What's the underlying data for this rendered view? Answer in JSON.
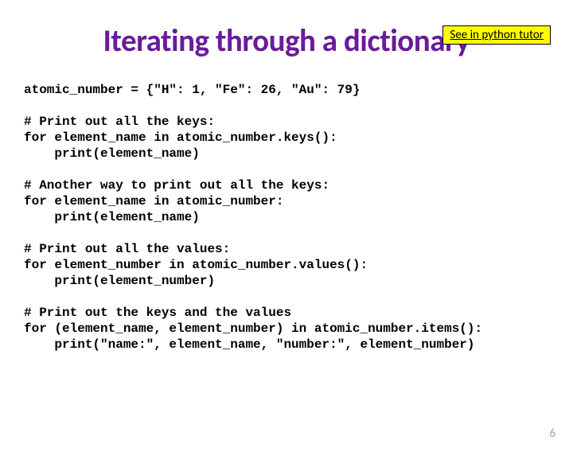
{
  "header": {
    "tutor_link": "See in python tutor"
  },
  "title": "Iterating through a dictionary",
  "code": {
    "line1": "atomic_number = {\"H\": 1, \"Fe\": 26, \"Au\": 79}",
    "block1_header": "# Print out all the keys:",
    "block1_line1": "for element_name in atomic_number.keys():",
    "block1_line2": "    print(element_name)",
    "block2_header": "# Another way to print out all the keys:",
    "block2_line1": "for element_name in atomic_number:",
    "block2_line2": "    print(element_name)",
    "block3_header": "# Print out all the values:",
    "block3_line1": "for element_number in atomic_number.values():",
    "block3_line2": "    print(element_number)",
    "block4_header": "# Print out the keys and the values",
    "block4_line1": "for (element_name, element_number) in atomic_number.items():",
    "block4_line2": "    print(\"name:\", element_name, \"number:\", element_number)"
  },
  "page_number": "6"
}
